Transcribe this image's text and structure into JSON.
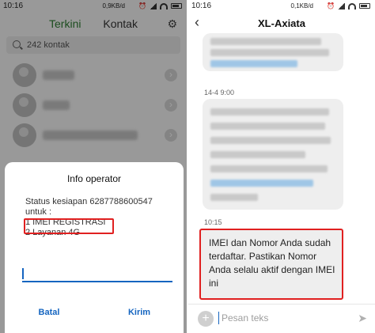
{
  "left": {
    "status": {
      "time": "10:16",
      "net": "0,9KB/d"
    },
    "tabs": {
      "active": "Terkini",
      "inactive": "Kontak"
    },
    "search": {
      "placeholder": "242 kontak"
    },
    "dialog": {
      "title": "Info operator",
      "lines": [
        "Status kesiapan 6287788600547",
        "untuk :",
        "1 IMEI REGISTRASI",
        "2 Layanan 4G"
      ],
      "buttons": {
        "cancel": "Batal",
        "send": "Kirim"
      }
    }
  },
  "right": {
    "status": {
      "time": "10:16",
      "net": "0,1KB/d"
    },
    "thread_title": "XL-Axiata",
    "timestamps": [
      "14-4 9:00",
      "10:15"
    ],
    "last_message": "IMEI dan Nomor Anda sudah terdaftar. Pastikan Nomor Anda selalu aktif dengan IMEI ini",
    "compose_placeholder": "Pesan teks"
  },
  "colors": {
    "accent": "#1565c0",
    "highlight": "#e02020",
    "tab_active": "#2e7d32"
  },
  "icons": [
    "settings-icon",
    "search-icon",
    "chevron-right-icon",
    "back-icon",
    "plus-icon",
    "send-icon"
  ]
}
